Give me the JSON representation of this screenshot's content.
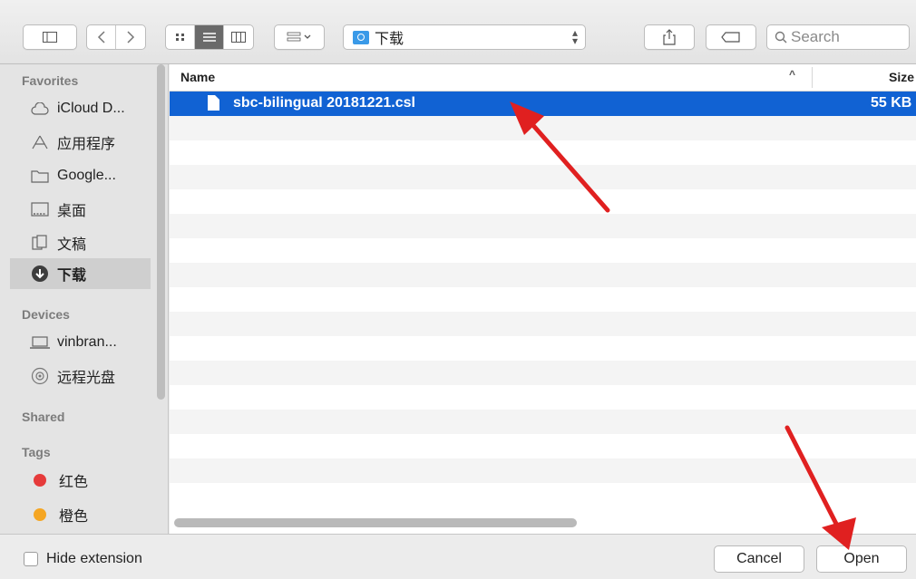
{
  "toolbar": {
    "location": "下载",
    "search_placeholder": "Search"
  },
  "sidebar": {
    "favorites_label": "Favorites",
    "favorites": [
      {
        "label": "iCloud D...",
        "icon": "cloud-icon"
      },
      {
        "label": "应用程序",
        "icon": "applications-icon"
      },
      {
        "label": "Google...",
        "icon": "folder-icon"
      },
      {
        "label": "桌面",
        "icon": "desktop-icon"
      },
      {
        "label": "文稿",
        "icon": "documents-icon"
      },
      {
        "label": "下载",
        "icon": "downloads-icon",
        "selected": true
      }
    ],
    "devices_label": "Devices",
    "devices": [
      {
        "label": "vinbran...",
        "icon": "laptop-icon"
      },
      {
        "label": "远程光盘",
        "icon": "disc-icon"
      }
    ],
    "shared_label": "Shared",
    "tags_label": "Tags",
    "tags": [
      {
        "label": "红色",
        "color": "#e63b3b"
      },
      {
        "label": "橙色",
        "color": "#f5a623"
      }
    ]
  },
  "list": {
    "col_name": "Name",
    "col_size": "Size",
    "files": [
      {
        "name": "sbc-bilingual 20181221.csl",
        "size": "55 KB",
        "selected": true
      }
    ]
  },
  "bottom": {
    "hide_extension": "Hide extension",
    "cancel": "Cancel",
    "open": "Open"
  },
  "colors": {
    "selection": "#1162d3",
    "arrow": "#e02020"
  }
}
